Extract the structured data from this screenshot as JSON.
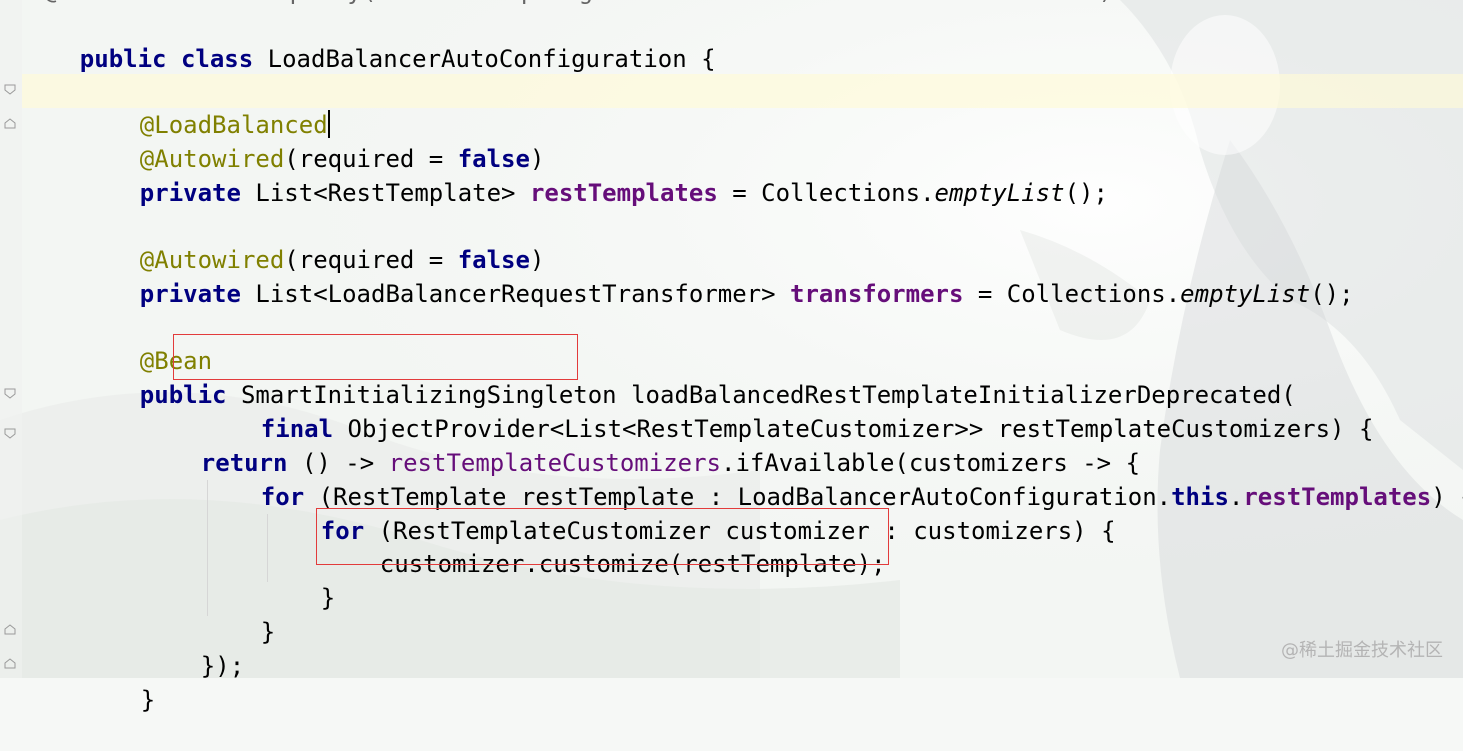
{
  "editor": {
    "cut_top_line": "@ConditionalOnProperty(value = \"spring.cloud.loadbalancer.ribbon.enabled\")",
    "lines": [
      {
        "tokens": [
          "public",
          " ",
          "class",
          " LoadBalancerAutoConfiguration {"
        ]
      },
      {
        "tokens": []
      },
      {
        "tokens": [
          "@LoadBalanced"
        ]
      },
      {
        "tokens": [
          "@Autowired",
          "(required = ",
          "false",
          ")"
        ]
      },
      {
        "tokens": [
          "private",
          " List<RestTemplate> ",
          "restTemplates",
          " = Collections.",
          "emptyList",
          "();"
        ]
      },
      {
        "tokens": []
      },
      {
        "tokens": [
          "@Autowired",
          "(required = ",
          "false",
          ")"
        ]
      },
      {
        "tokens": [
          "private",
          " List<LoadBalancerRequestTransformer> ",
          "transformers",
          " = Collections.",
          "emptyList",
          "();"
        ]
      },
      {
        "tokens": []
      },
      {
        "tokens": [
          "@Bean"
        ]
      },
      {
        "tokens": [
          "public",
          " ",
          "SmartInitializingSingleton",
          " loadBalancedRestTemplateInitializerDeprecated("
        ]
      },
      {
        "tokens": [
          "final",
          " ObjectProvider<List<RestTemplateCustomizer>> restTemplateCustomizers) {"
        ]
      },
      {
        "tokens": [
          "return",
          " () -> ",
          "restTemplateCustomizers",
          ".ifAvailable(customizers -> {"
        ]
      },
      {
        "tokens": [
          "for",
          " (RestTemplate restTemplate : LoadBalancerAutoConfiguration.",
          "this",
          ".",
          "restTemplates",
          ") {"
        ]
      },
      {
        "tokens": [
          "for",
          " (RestTemplateCustomizer customizer : customizers) {"
        ]
      },
      {
        "tokens": [
          "customizer.customize(restTemplate);"
        ]
      },
      {
        "tokens": [
          "}"
        ]
      },
      {
        "tokens": [
          "}"
        ]
      },
      {
        "tokens": [
          "});"
        ]
      },
      {
        "tokens": [
          "}"
        ]
      }
    ]
  },
  "colors": {
    "keyword": "#000080",
    "annotation": "#808000",
    "field": "#660e7a",
    "highlight_box": "#e23b3b",
    "current_line": "#fffad7"
  },
  "watermark": "@稀土掘金技术社区"
}
